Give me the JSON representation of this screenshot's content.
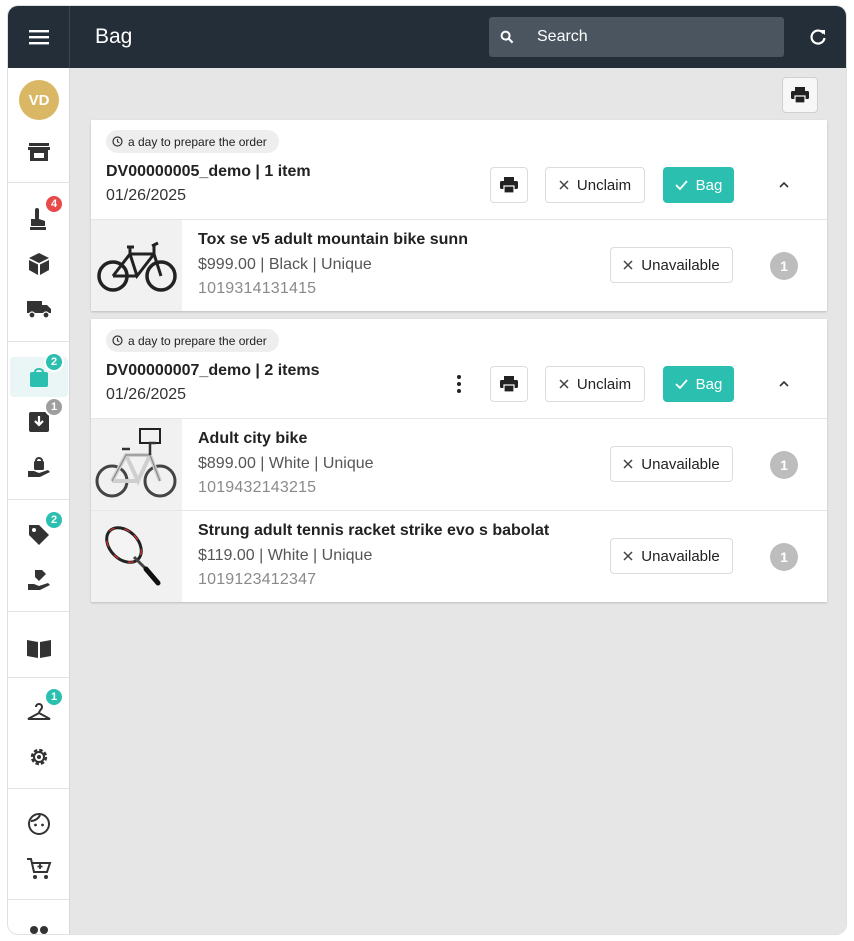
{
  "header": {
    "title": "Bag",
    "search_placeholder": "Search",
    "icons": {
      "menu": "hamburger-icon",
      "search": "search-icon",
      "refresh": "refresh-icon"
    }
  },
  "sidebar": {
    "avatar_initials": "VD",
    "avatar_color": "#d9b764",
    "items": [
      {
        "name": "store",
        "icon": "store-icon"
      },
      {
        "name": "pick",
        "icon": "hand-pointer-icon",
        "badge": "4",
        "badge_color": "#e84a4a"
      },
      {
        "name": "packages",
        "icon": "cube-icon"
      },
      {
        "name": "shipping",
        "icon": "truck-icon"
      },
      {
        "name": "bag",
        "icon": "bag-icon",
        "badge": "2",
        "badge_color": "#2bbfb0",
        "active": true
      },
      {
        "name": "receive",
        "icon": "inbox-download-icon",
        "badge": "1",
        "badge_color": "#9e9e9e"
      },
      {
        "name": "handover",
        "icon": "hand-bag-icon"
      },
      {
        "name": "tags",
        "icon": "tag-icon",
        "badge": "2",
        "badge_color": "#2bbfb0"
      },
      {
        "name": "handover-tags",
        "icon": "hand-tag-icon"
      },
      {
        "name": "catalog",
        "icon": "book-icon"
      },
      {
        "name": "hanger",
        "icon": "hanger-icon",
        "badge": "1",
        "badge_color": "#2bbfb0"
      },
      {
        "name": "settings",
        "icon": "gear-icon"
      },
      {
        "name": "customer",
        "icon": "face-icon"
      },
      {
        "name": "cart",
        "icon": "cart-icon"
      },
      {
        "name": "team",
        "icon": "people-icon"
      }
    ]
  },
  "toolbar": {
    "print_icon": "printer-icon"
  },
  "colors": {
    "accent": "#2bbfb0",
    "topbar": "#232e38",
    "background": "#e6e6e6"
  },
  "orders": [
    {
      "chip": "a day to prepare the order",
      "order_label": "DV00000005_demo | 1 item",
      "date": "01/26/2025",
      "has_more_menu": false,
      "unclaim_label": "Unclaim",
      "bag_label": "Bag",
      "items": [
        {
          "name": "Tox se v5 adult mountain bike sunn",
          "meta": "$999.00 | Black | Unique",
          "sku": "1019314131415",
          "unavailable_label": "Unavailable",
          "qty": "1",
          "image": "mountain-bike-image"
        }
      ]
    },
    {
      "chip": "a day to prepare the order",
      "order_label": "DV00000007_demo | 2 items",
      "date": "01/26/2025",
      "has_more_menu": true,
      "unclaim_label": "Unclaim",
      "bag_label": "Bag",
      "items": [
        {
          "name": "Adult city bike",
          "meta": "$899.00 | White | Unique",
          "sku": "1019432143215",
          "unavailable_label": "Unavailable",
          "qty": "1",
          "image": "city-bike-image"
        },
        {
          "name": "Strung adult tennis racket strike evo s babolat",
          "meta": "$119.00 | White | Unique",
          "sku": "1019123412347",
          "unavailable_label": "Unavailable",
          "qty": "1",
          "image": "tennis-racket-image"
        }
      ]
    }
  ]
}
